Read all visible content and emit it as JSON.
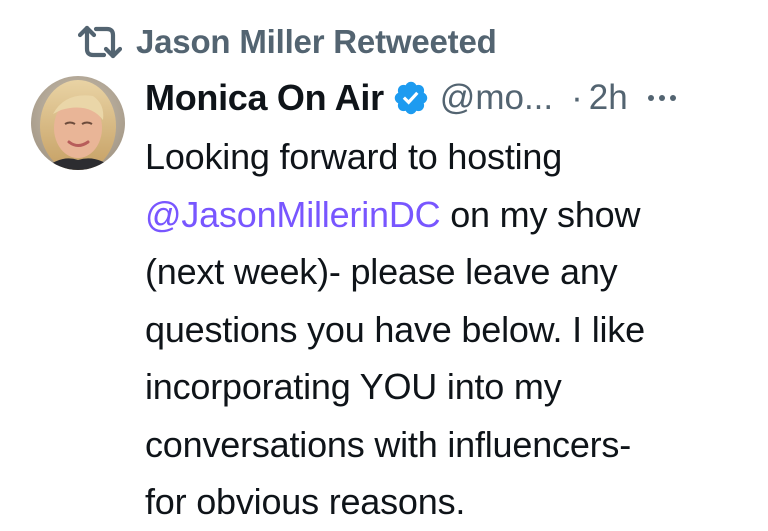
{
  "social_context": {
    "icon": "retweet-icon",
    "text": "Jason Miller Retweeted"
  },
  "tweet": {
    "author": {
      "display_name": "Monica On Air",
      "verified": true,
      "handle": "@mo...",
      "avatar": "avatar"
    },
    "separator": "·",
    "time": "2h",
    "more_icon": "more-icon",
    "text_lines": [
      {
        "before": "Looking forward to hosting",
        "mention": "",
        "after": ""
      },
      {
        "before": "",
        "mention": "@JasonMillerinDC",
        "after": " on my show"
      },
      {
        "before": "(next week)- please leave any",
        "mention": "",
        "after": ""
      },
      {
        "before": "questions you have below. I like",
        "mention": "",
        "after": ""
      },
      {
        "before": "incorporating YOU into my",
        "mention": "",
        "after": ""
      },
      {
        "before": "conversations with influencers-",
        "mention": "",
        "after": ""
      },
      {
        "before": "for obvious reasons.",
        "mention": "",
        "after": ""
      }
    ]
  },
  "colors": {
    "text_primary": "#0f1419",
    "text_secondary": "#536471",
    "mention": "#7856ff",
    "verified": "#1d9bf0"
  }
}
